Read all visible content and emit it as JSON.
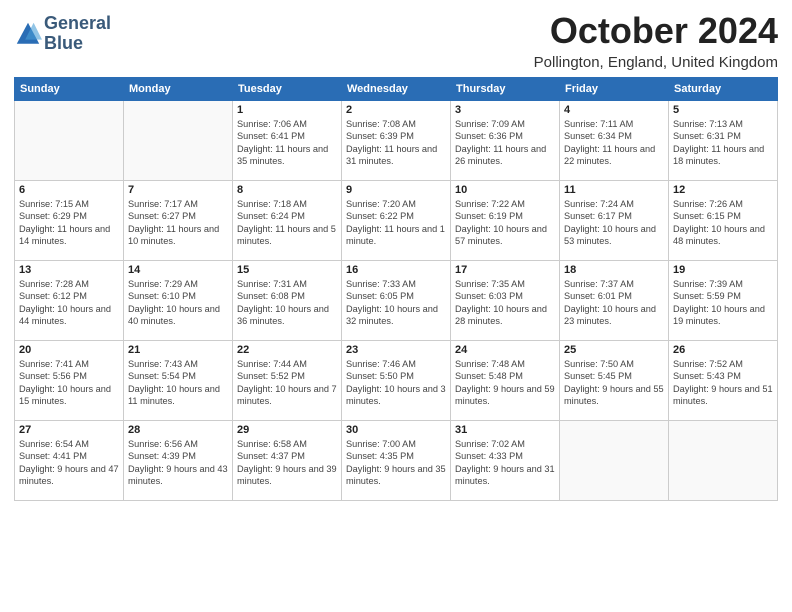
{
  "header": {
    "logo_line1": "General",
    "logo_line2": "Blue",
    "title": "October 2024",
    "subtitle": "Pollington, England, United Kingdom"
  },
  "days_of_week": [
    "Sunday",
    "Monday",
    "Tuesday",
    "Wednesday",
    "Thursday",
    "Friday",
    "Saturday"
  ],
  "weeks": [
    [
      {
        "day": "",
        "detail": ""
      },
      {
        "day": "",
        "detail": ""
      },
      {
        "day": "1",
        "detail": "Sunrise: 7:06 AM\nSunset: 6:41 PM\nDaylight: 11 hours and 35 minutes."
      },
      {
        "day": "2",
        "detail": "Sunrise: 7:08 AM\nSunset: 6:39 PM\nDaylight: 11 hours and 31 minutes."
      },
      {
        "day": "3",
        "detail": "Sunrise: 7:09 AM\nSunset: 6:36 PM\nDaylight: 11 hours and 26 minutes."
      },
      {
        "day": "4",
        "detail": "Sunrise: 7:11 AM\nSunset: 6:34 PM\nDaylight: 11 hours and 22 minutes."
      },
      {
        "day": "5",
        "detail": "Sunrise: 7:13 AM\nSunset: 6:31 PM\nDaylight: 11 hours and 18 minutes."
      }
    ],
    [
      {
        "day": "6",
        "detail": "Sunrise: 7:15 AM\nSunset: 6:29 PM\nDaylight: 11 hours and 14 minutes."
      },
      {
        "day": "7",
        "detail": "Sunrise: 7:17 AM\nSunset: 6:27 PM\nDaylight: 11 hours and 10 minutes."
      },
      {
        "day": "8",
        "detail": "Sunrise: 7:18 AM\nSunset: 6:24 PM\nDaylight: 11 hours and 5 minutes."
      },
      {
        "day": "9",
        "detail": "Sunrise: 7:20 AM\nSunset: 6:22 PM\nDaylight: 11 hours and 1 minute."
      },
      {
        "day": "10",
        "detail": "Sunrise: 7:22 AM\nSunset: 6:19 PM\nDaylight: 10 hours and 57 minutes."
      },
      {
        "day": "11",
        "detail": "Sunrise: 7:24 AM\nSunset: 6:17 PM\nDaylight: 10 hours and 53 minutes."
      },
      {
        "day": "12",
        "detail": "Sunrise: 7:26 AM\nSunset: 6:15 PM\nDaylight: 10 hours and 48 minutes."
      }
    ],
    [
      {
        "day": "13",
        "detail": "Sunrise: 7:28 AM\nSunset: 6:12 PM\nDaylight: 10 hours and 44 minutes."
      },
      {
        "day": "14",
        "detail": "Sunrise: 7:29 AM\nSunset: 6:10 PM\nDaylight: 10 hours and 40 minutes."
      },
      {
        "day": "15",
        "detail": "Sunrise: 7:31 AM\nSunset: 6:08 PM\nDaylight: 10 hours and 36 minutes."
      },
      {
        "day": "16",
        "detail": "Sunrise: 7:33 AM\nSunset: 6:05 PM\nDaylight: 10 hours and 32 minutes."
      },
      {
        "day": "17",
        "detail": "Sunrise: 7:35 AM\nSunset: 6:03 PM\nDaylight: 10 hours and 28 minutes."
      },
      {
        "day": "18",
        "detail": "Sunrise: 7:37 AM\nSunset: 6:01 PM\nDaylight: 10 hours and 23 minutes."
      },
      {
        "day": "19",
        "detail": "Sunrise: 7:39 AM\nSunset: 5:59 PM\nDaylight: 10 hours and 19 minutes."
      }
    ],
    [
      {
        "day": "20",
        "detail": "Sunrise: 7:41 AM\nSunset: 5:56 PM\nDaylight: 10 hours and 15 minutes."
      },
      {
        "day": "21",
        "detail": "Sunrise: 7:43 AM\nSunset: 5:54 PM\nDaylight: 10 hours and 11 minutes."
      },
      {
        "day": "22",
        "detail": "Sunrise: 7:44 AM\nSunset: 5:52 PM\nDaylight: 10 hours and 7 minutes."
      },
      {
        "day": "23",
        "detail": "Sunrise: 7:46 AM\nSunset: 5:50 PM\nDaylight: 10 hours and 3 minutes."
      },
      {
        "day": "24",
        "detail": "Sunrise: 7:48 AM\nSunset: 5:48 PM\nDaylight: 9 hours and 59 minutes."
      },
      {
        "day": "25",
        "detail": "Sunrise: 7:50 AM\nSunset: 5:45 PM\nDaylight: 9 hours and 55 minutes."
      },
      {
        "day": "26",
        "detail": "Sunrise: 7:52 AM\nSunset: 5:43 PM\nDaylight: 9 hours and 51 minutes."
      }
    ],
    [
      {
        "day": "27",
        "detail": "Sunrise: 6:54 AM\nSunset: 4:41 PM\nDaylight: 9 hours and 47 minutes."
      },
      {
        "day": "28",
        "detail": "Sunrise: 6:56 AM\nSunset: 4:39 PM\nDaylight: 9 hours and 43 minutes."
      },
      {
        "day": "29",
        "detail": "Sunrise: 6:58 AM\nSunset: 4:37 PM\nDaylight: 9 hours and 39 minutes."
      },
      {
        "day": "30",
        "detail": "Sunrise: 7:00 AM\nSunset: 4:35 PM\nDaylight: 9 hours and 35 minutes."
      },
      {
        "day": "31",
        "detail": "Sunrise: 7:02 AM\nSunset: 4:33 PM\nDaylight: 9 hours and 31 minutes."
      },
      {
        "day": "",
        "detail": ""
      },
      {
        "day": "",
        "detail": ""
      }
    ]
  ]
}
